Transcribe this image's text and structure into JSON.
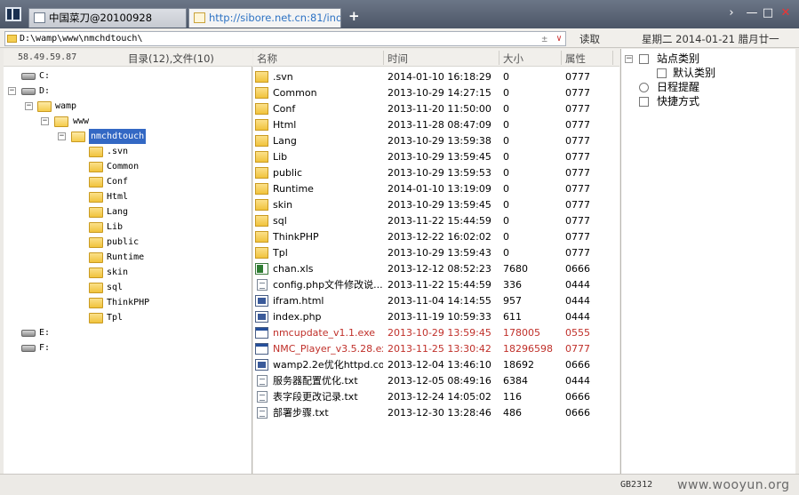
{
  "tabs": [
    {
      "label": "中国菜刀@20100928",
      "active": false
    },
    {
      "label": "http://sibore.net.cn:81/index....",
      "active": true
    }
  ],
  "new_tab_label": "+",
  "window_controls": {
    "dropdown": "›",
    "minimize": "—",
    "maximize": "□",
    "close": "✕"
  },
  "address": {
    "path": "D:\\wamp\\www\\nmchdtouch\\",
    "pin": "±",
    "dropdown": "∨"
  },
  "read_button": "读取",
  "date_text": "星期二 2014-01-21 腊月廿一",
  "left_header": {
    "ip": "58.49.59.87",
    "summary": "目录(12),文件(10)"
  },
  "tree": {
    "drive_c": "C:",
    "drive_d": "D:",
    "wamp": "wamp",
    "www": "www",
    "selected": "nmchdtouch",
    "children": [
      ".svn",
      "Common",
      "Conf",
      "Html",
      "Lang",
      "Lib",
      "public",
      "Runtime",
      "skin",
      "sql",
      "ThinkPHP",
      "Tpl"
    ],
    "drive_e": "E:",
    "drive_f": "F:",
    "expand_minus": "−"
  },
  "columns": {
    "name": "名称",
    "time": "时间",
    "size": "大小",
    "attr": "属性"
  },
  "files": [
    {
      "name": ".svn",
      "time": "2014-01-10 16:18:29",
      "size": "0",
      "attr": "0777",
      "icon": "folder",
      "red": false
    },
    {
      "name": "Common",
      "time": "2013-10-29 14:27:15",
      "size": "0",
      "attr": "0777",
      "icon": "folder",
      "red": false
    },
    {
      "name": "Conf",
      "time": "2013-11-20 11:50:00",
      "size": "0",
      "attr": "0777",
      "icon": "folder",
      "red": false
    },
    {
      "name": "Html",
      "time": "2013-11-28 08:47:09",
      "size": "0",
      "attr": "0777",
      "icon": "folder",
      "red": false
    },
    {
      "name": "Lang",
      "time": "2013-10-29 13:59:38",
      "size": "0",
      "attr": "0777",
      "icon": "folder",
      "red": false
    },
    {
      "name": "Lib",
      "time": "2013-10-29 13:59:45",
      "size": "0",
      "attr": "0777",
      "icon": "folder",
      "red": false
    },
    {
      "name": "public",
      "time": "2013-10-29 13:59:53",
      "size": "0",
      "attr": "0777",
      "icon": "folder",
      "red": false
    },
    {
      "name": "Runtime",
      "time": "2014-01-10 13:19:09",
      "size": "0",
      "attr": "0777",
      "icon": "folder",
      "red": false
    },
    {
      "name": "skin",
      "time": "2013-10-29 13:59:45",
      "size": "0",
      "attr": "0777",
      "icon": "folder",
      "red": false
    },
    {
      "name": "sql",
      "time": "2013-11-22 15:44:59",
      "size": "0",
      "attr": "0777",
      "icon": "folder",
      "red": false
    },
    {
      "name": "ThinkPHP",
      "time": "2013-12-22 16:02:02",
      "size": "0",
      "attr": "0777",
      "icon": "folder",
      "red": false
    },
    {
      "name": "Tpl",
      "time": "2013-10-29 13:59:43",
      "size": "0",
      "attr": "0777",
      "icon": "folder",
      "red": false
    },
    {
      "name": "chan.xls",
      "time": "2013-12-12 08:52:23",
      "size": "7680",
      "attr": "0666",
      "icon": "xls",
      "red": false
    },
    {
      "name": "config.php文件修改说...",
      "time": "2013-11-22 15:44:59",
      "size": "336",
      "attr": "0444",
      "icon": "txt",
      "red": false
    },
    {
      "name": "ifram.html",
      "time": "2013-11-04 14:14:55",
      "size": "957",
      "attr": "0444",
      "icon": "page",
      "red": false
    },
    {
      "name": "index.php",
      "time": "2013-11-19 10:59:33",
      "size": "611",
      "attr": "0444",
      "icon": "page",
      "red": false
    },
    {
      "name": "nmcupdate_v1.1.exe",
      "time": "2013-10-29 13:59:45",
      "size": "178005",
      "attr": "0555",
      "icon": "exe",
      "red": true
    },
    {
      "name": "NMC_Player_v3.5.28.exe",
      "time": "2013-11-25 13:30:42",
      "size": "18296598",
      "attr": "0777",
      "icon": "exe",
      "red": true
    },
    {
      "name": "wamp2.2e优化httpd.conf",
      "time": "2013-12-04 13:46:10",
      "size": "18692",
      "attr": "0666",
      "icon": "page",
      "red": false
    },
    {
      "name": "服务器配置优化.txt",
      "time": "2013-12-05 08:49:16",
      "size": "6384",
      "attr": "0444",
      "icon": "txt",
      "red": false
    },
    {
      "name": "表字段更改记录.txt",
      "time": "2013-12-24 14:05:02",
      "size": "116",
      "attr": "0666",
      "icon": "txt",
      "red": false
    },
    {
      "name": "部署步骤.txt",
      "time": "2013-12-30 13:28:46",
      "size": "486",
      "attr": "0666",
      "icon": "txt",
      "red": false
    }
  ],
  "right_panel": {
    "site_category": "站点类别",
    "default_category": "默认类别",
    "schedule": "日程提醒",
    "shortcuts": "快捷方式",
    "expand_minus": "−"
  },
  "status": {
    "encoding": "GB2312",
    "watermark": "www.wooyun.org"
  },
  "colors": {
    "selection": "#3368c4",
    "red_file": "#c0302a",
    "active_tab_text": "#2e73c4"
  }
}
